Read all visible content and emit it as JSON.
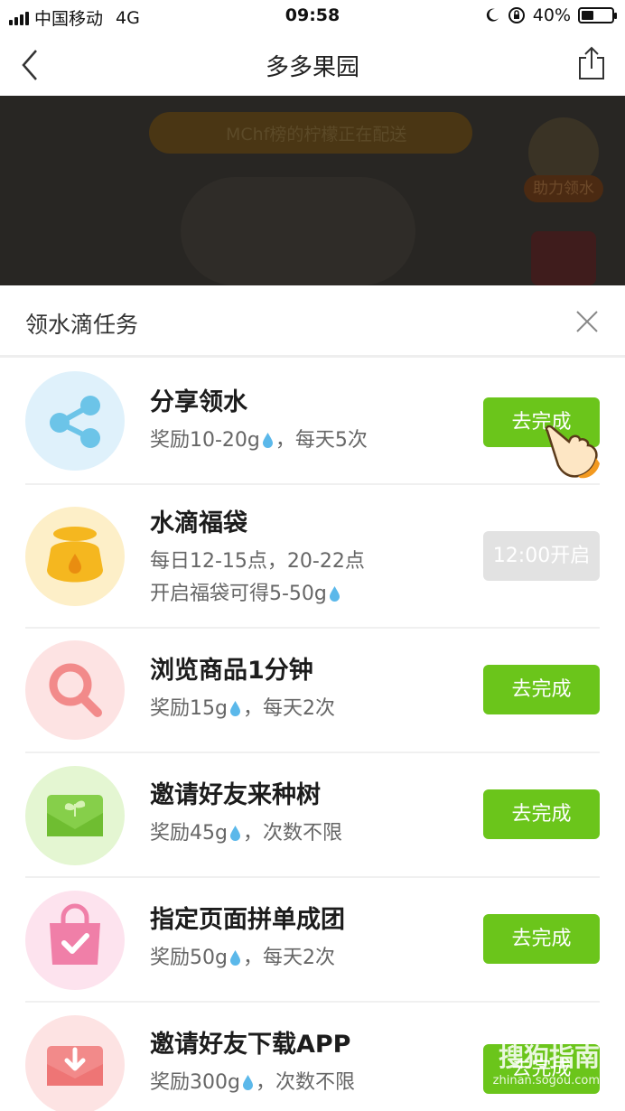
{
  "status_bar": {
    "carrier": "中国移动",
    "network": "4G",
    "time": "09:58",
    "battery_text": "40%",
    "battery_level": 0.4
  },
  "nav": {
    "title": "多多果园",
    "back_icon": "chevron-left-icon",
    "share_icon": "share-icon"
  },
  "game": {
    "banner_text": "MChf榜的柠檬正在配送",
    "badge_label": "助力领水"
  },
  "sheet": {
    "title": "领水滴任务",
    "close_icon": "close-icon"
  },
  "tasks": [
    {
      "title": "分享领水",
      "desc_line1_pre": "奖励10-20g",
      "desc_line1_post": "，每天5次",
      "button": "去完成",
      "enabled": true,
      "icon": "share-nodes-icon",
      "icon_bg": "#dff1fb",
      "icon_color": "#6cc4e8"
    },
    {
      "title": "水滴福袋",
      "desc_line1": "每日12-15点，20-22点",
      "desc_line2_pre": "开启福袋可得5-50g",
      "button": "12:00开启",
      "enabled": false,
      "icon": "lucky-bag-icon",
      "icon_bg": "#fdefc8",
      "icon_color": "#f5b71f"
    },
    {
      "title": "浏览商品1分钟",
      "desc_line1_pre": "奖励15g",
      "desc_line1_post": "，每天2次",
      "button": "去完成",
      "enabled": true,
      "icon": "magnifier-icon",
      "icon_bg": "#fde3e3",
      "icon_color": "#f28a8a"
    },
    {
      "title": "邀请好友来种树",
      "desc_line1_pre": "奖励45g",
      "desc_line1_post": "，次数不限",
      "button": "去完成",
      "enabled": true,
      "icon": "sprout-envelope-icon",
      "icon_bg": "#e4f6d2",
      "icon_color": "#86cf4a"
    },
    {
      "title": "指定页面拼单成团",
      "desc_line1_pre": "奖励50g",
      "desc_line1_post": "，每天2次",
      "button": "去完成",
      "enabled": true,
      "icon": "shopping-bag-icon",
      "icon_bg": "#fde3ee",
      "icon_color": "#f07fa8"
    },
    {
      "title": "邀请好友下载APP",
      "desc_line1_pre": "奖励300g",
      "desc_line1_post": "，次数不限",
      "button": "去完成",
      "enabled": true,
      "icon": "download-envelope-icon",
      "icon_bg": "#fde3e3",
      "icon_color": "#f28a8a"
    }
  ],
  "watermark": {
    "brand": "搜狗指南",
    "url": "zhinan.sogou.com"
  },
  "colors": {
    "accent_green": "#6bc51b",
    "disabled_gray": "#e2e2e2",
    "drop_blue": "#5bb8ea"
  }
}
